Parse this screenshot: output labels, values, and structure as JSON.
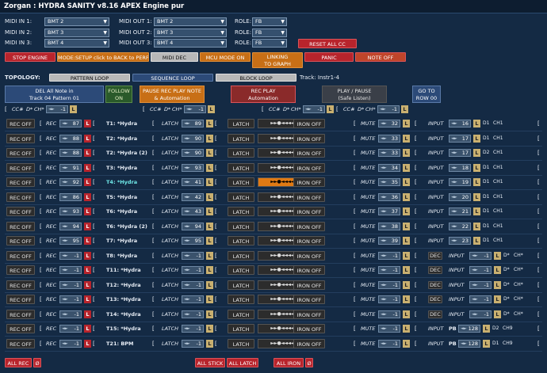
{
  "window_title": "Zorgan : HYDRA SANITY v8.16 APEX Engine pur",
  "midi_in": [
    {
      "label": "MIDI IN 1:",
      "value": "BMT 2"
    },
    {
      "label": "MIDI IN 2:",
      "value": "BMT 3"
    },
    {
      "label": "MIDI IN 3:",
      "value": "BMT 4"
    }
  ],
  "midi_out": [
    {
      "label": "MIDI OUT 1:",
      "value": "BMT 2"
    },
    {
      "label": "MIDI OUT 2:",
      "value": "BMT 3"
    },
    {
      "label": "MIDI OUT 3:",
      "value": "BMT 4"
    }
  ],
  "role": [
    {
      "label": "ROLE:",
      "value": "FB"
    },
    {
      "label": "ROLE:",
      "value": "FB"
    },
    {
      "label": "ROLE:",
      "value": "FB"
    }
  ],
  "reset_all_cc": "RESET ALL CC",
  "toolbar": {
    "stop_engine": "STOP ENGINE",
    "mode_setup": "MODE:SETUP click to BACK to PERF",
    "midi_dec": "MIDI DEC",
    "mcu_mode": "MCU MODE ON",
    "linking": "LINKING",
    "to_graph": "TO GRAPH",
    "panic": "PANIC",
    "note_off": "NOTE OFF"
  },
  "topology": {
    "label": "TOPOLOGY:",
    "pattern_loop": "PATTERN LOOP",
    "sequence_loop": "SEQUENCE LOOP",
    "block_loop": "BLOCK LOOP",
    "track": "Track: Instr1-4"
  },
  "actions": {
    "del_line1": "DEL All Note in",
    "del_line2": "Track 04 Pattern 01",
    "follow_line1": "FOLLOW",
    "follow_line2": "ON",
    "pause_line1": "PAUSE REC PLAY NOTE",
    "pause_line2": "& Automation",
    "rec_line1": "REC PLAY",
    "rec_line2": "Automation",
    "play_line1": "PLAY / PAUSE",
    "play_line2": "(Safe Listen)",
    "goto_line1": "GO TO",
    "goto_line2": "ROW 00"
  },
  "cc_headers": [
    {
      "bracket": "[",
      "cc": "CC#",
      "d": "D*",
      "ch": "CH*",
      "val": "-1",
      "l": "L"
    },
    {
      "bracket": "[",
      "cc": "CC#",
      "d": "D*",
      "ch": "CH*",
      "val": "-1",
      "l": "L"
    },
    {
      "bracket": "[",
      "cc": "CC#",
      "d": "D*",
      "ch": "CH*",
      "val": "-1",
      "l": "L"
    },
    {
      "bracket": "[",
      "cc": "CC#",
      "d": "D*",
      "ch": "CH*",
      "val": "-1",
      "l": "L"
    }
  ],
  "row_labels": {
    "rec_off": "REC OFF",
    "rec": "REC",
    "latch_it": "LATCH",
    "latch_btn": "LATCH",
    "transport": "►►●◄◄◄◄",
    "iron_off": "IRON OFF",
    "mute": "MUTE",
    "input": "INPUT",
    "dec": "DEC",
    "l": "L",
    "bracket": "[",
    "d_star": "D*",
    "ch_star": "CH*",
    "pb": "PB"
  },
  "rows": [
    {
      "rec_val": "87",
      "name": "T1: *Hydra",
      "latch_val": "89",
      "mute_val": "32",
      "in_val": "16",
      "d": "D1",
      "ch": "CH1",
      "rl": "L",
      "hl": false,
      "cyan": false,
      "dec": false,
      "pb": false
    },
    {
      "rec_val": "88",
      "name": "T2: *Hydra",
      "latch_val": "90",
      "mute_val": "33",
      "in_val": "17",
      "d": "D1",
      "ch": "CH1",
      "rl": "L",
      "hl": false,
      "cyan": false,
      "dec": false,
      "pb": false
    },
    {
      "rec_val": "88",
      "name": "T2: *Hydra (2)",
      "latch_val": "90",
      "mute_val": "33",
      "in_val": "17",
      "d": "D2",
      "ch": "CH1",
      "rl": "L",
      "hl": false,
      "cyan": false,
      "dec": false,
      "pb": false
    },
    {
      "rec_val": "91",
      "name": "T3: *Hydra",
      "latch_val": "93",
      "mute_val": "34",
      "in_val": "18",
      "d": "D1",
      "ch": "CH1",
      "rl": "L",
      "hl": false,
      "cyan": false,
      "dec": false,
      "pb": false
    },
    {
      "rec_val": "92",
      "name": "T4: *Hydra",
      "latch_val": "41",
      "mute_val": "35",
      "in_val": "19",
      "d": "D1",
      "ch": "CH1",
      "rl": "L",
      "hl": true,
      "cyan": true,
      "dec": false,
      "pb": false
    },
    {
      "rec_val": "86",
      "name": "T5: *Hydra",
      "latch_val": "42",
      "mute_val": "36",
      "in_val": "20",
      "d": "D1",
      "ch": "CH1",
      "rl": "L",
      "hl": false,
      "cyan": false,
      "dec": false,
      "pb": false
    },
    {
      "rec_val": "93",
      "name": "T6: *Hydra",
      "latch_val": "43",
      "mute_val": "37",
      "in_val": "21",
      "d": "D1",
      "ch": "CH1",
      "rl": "L",
      "hl": false,
      "cyan": false,
      "dec": false,
      "pb": false
    },
    {
      "rec_val": "94",
      "name": "T6: *Hydra (2)",
      "latch_val": "94",
      "mute_val": "38",
      "in_val": "22",
      "d": "D1",
      "ch": "CH1",
      "rl": "L",
      "hl": false,
      "cyan": false,
      "dec": false,
      "pb": false
    },
    {
      "rec_val": "95",
      "name": "T7: *Hydra",
      "latch_val": "95",
      "mute_val": "39",
      "in_val": "23",
      "d": "D1",
      "ch": "CH1",
      "rl": "L",
      "hl": false,
      "cyan": false,
      "dec": false,
      "pb": false
    },
    {
      "rec_val": "-1",
      "name": "T8: *Hydra",
      "latch_val": "-1",
      "mute_val": "-1",
      "in_val": "-1",
      "d": "D*",
      "ch": "CH*",
      "rl": "L",
      "hl": false,
      "cyan": false,
      "dec": true,
      "pb": false
    },
    {
      "rec_val": "-1",
      "name": "T11: *Hydra",
      "latch_val": "-1",
      "mute_val": "-1",
      "in_val": "-1",
      "d": "D*",
      "ch": "CH*",
      "rl": "L",
      "hl": false,
      "cyan": false,
      "dec": true,
      "pb": false
    },
    {
      "rec_val": "-1",
      "name": "T12: *Hydra",
      "latch_val": "-1",
      "mute_val": "-1",
      "in_val": "-1",
      "d": "D*",
      "ch": "CH*",
      "rl": "L",
      "hl": false,
      "cyan": false,
      "dec": true,
      "pb": false
    },
    {
      "rec_val": "-1",
      "name": "T13: *Hydra",
      "latch_val": "-1",
      "mute_val": "-1",
      "in_val": "-1",
      "d": "D*",
      "ch": "CH*",
      "rl": "L",
      "hl": false,
      "cyan": false,
      "dec": true,
      "pb": false
    },
    {
      "rec_val": "-1",
      "name": "T14: *Hydra",
      "latch_val": "-1",
      "mute_val": "-1",
      "in_val": "-1",
      "d": "D*",
      "ch": "CH*",
      "rl": "L",
      "hl": false,
      "cyan": false,
      "dec": true,
      "pb": false
    },
    {
      "rec_val": "-1",
      "name": "T15: *Hydra",
      "latch_val": "-1",
      "mute_val": "-1",
      "in_val": "128",
      "d": "D2",
      "ch": "CH9",
      "rl": "L",
      "hl": false,
      "cyan": false,
      "dec": false,
      "pb": true
    },
    {
      "rec_val": "-1",
      "name": "T21: BPM",
      "latch_val": "-1",
      "mute_val": "-1",
      "in_val": "128",
      "d": "D1",
      "ch": "CH9",
      "rl": "L",
      "hl": false,
      "cyan": false,
      "dec": false,
      "pb": true
    }
  ],
  "footer": {
    "all_rec": "ALL REC",
    "o1": "Ø",
    "all_stick": "ALL STICK",
    "all_latch": "ALL LATCH",
    "all_iron": "ALL IRON",
    "o2": "Ø"
  }
}
